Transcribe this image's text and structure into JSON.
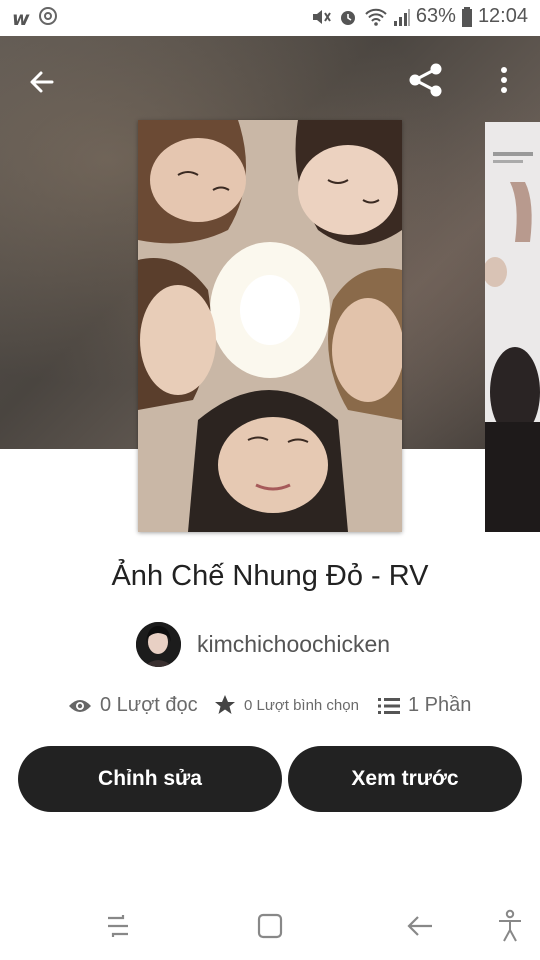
{
  "status_bar": {
    "app_letter": "w",
    "battery_percent": "63%",
    "time": "12:04"
  },
  "toolbar": {
    "back_icon": "arrow-left-icon",
    "share_icon": "share-icon",
    "more_icon": "more-vertical-icon"
  },
  "story": {
    "title": "Ảnh Chế Nhung Đỏ - RV",
    "author": "kimchichoochicken"
  },
  "stats": {
    "reads": "0 Lượt đọc",
    "votes": "0 Lượt bình chọn",
    "parts": "1 Phần"
  },
  "actions": {
    "edit_label": "Chỉnh sửa",
    "preview_label": "Xem trước"
  },
  "colors": {
    "button_bg": "#222222",
    "hero_bg": "#4a4540"
  }
}
